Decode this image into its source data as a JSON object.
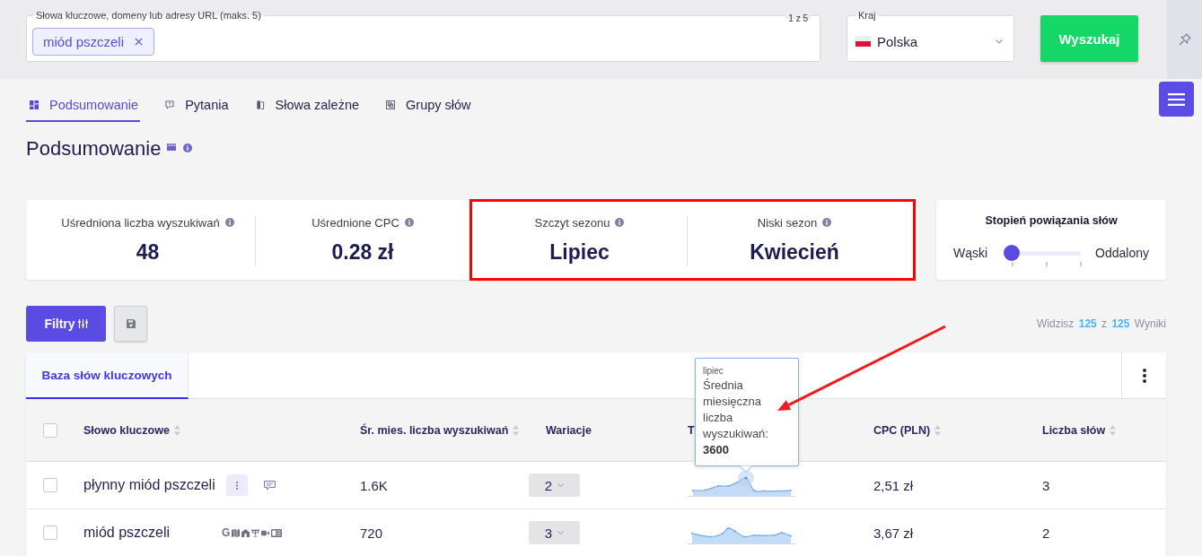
{
  "search": {
    "label": "Słowa kluczowe, domeny lub adresy URL (maks. 5)",
    "counter": "1 z 5",
    "chips": [
      "miód pszczeli"
    ]
  },
  "country": {
    "label": "Kraj",
    "value": "Polska"
  },
  "search_button": "Wyszukaj",
  "tabs": [
    {
      "label": "Podsumowanie",
      "selected": true
    },
    {
      "label": "Pytania",
      "selected": false
    },
    {
      "label": "Słowa zależne",
      "selected": false
    },
    {
      "label": "Grupy słów",
      "selected": false
    }
  ],
  "page_title": "Podsumowanie",
  "stats": [
    {
      "label": "Uśredniona liczba wyszukiwań",
      "value": "48",
      "highlighted": false
    },
    {
      "label": "Uśrednione CPC",
      "value": "0.28 zł",
      "highlighted": false
    },
    {
      "label": "Szczyt sezonu",
      "value": "Lipiec",
      "highlighted": true
    },
    {
      "label": "Niski sezon",
      "value": "Kwiecień",
      "highlighted": true
    }
  ],
  "relevance": {
    "title": "Stopień powiązania słów",
    "min_label": "Wąski",
    "max_label": "Oddalony",
    "level": 0
  },
  "toolbar": {
    "filter_button": "Filtry",
    "results": "Widzisz **125** z **125** Wyniki"
  },
  "table": {
    "tabs": [
      {
        "label": "Baza słów kluczowych",
        "selected": true
      }
    ],
    "select_all_checked": false,
    "columns": [
      {
        "label": "Słowo kluczowe",
        "sortable": true
      },
      {
        "label": "Śr. mies. liczba wyszukiwań",
        "sortable": true
      },
      {
        "label": "Wariacje",
        "sortable": false
      },
      {
        "label": "T",
        "sortable": false
      },
      {
        "label": "CPC (PLN)",
        "sortable": true
      },
      {
        "label": "Liczba słów",
        "sortable": true
      }
    ],
    "rows": [
      {
        "checked": false,
        "keyword": "płynny miód pszczeli",
        "hovered": true,
        "features": [
          {
            "kind": "speech"
          }
        ],
        "searches": "1.6K",
        "variations": "2",
        "trend_tooltip": {
          "title": "lipiec",
          "text": "Średnia miesięczna liczba wyszukiwań: **3600**"
        },
        "cpc": "2,51 zł",
        "words": "3"
      },
      {
        "checked": false,
        "keyword": "miód pszczeli",
        "hovered": false,
        "features": [
          {
            "kind": "letter",
            "label": "G"
          },
          {
            "kind": "map"
          },
          {
            "kind": "house"
          },
          {
            "kind": "candelabra"
          },
          {
            "kind": "video"
          },
          {
            "kind": "newspaper"
          }
        ],
        "searches": "720",
        "variations": "3",
        "cpc": "3,67 zł",
        "words": "2"
      }
    ]
  }
}
